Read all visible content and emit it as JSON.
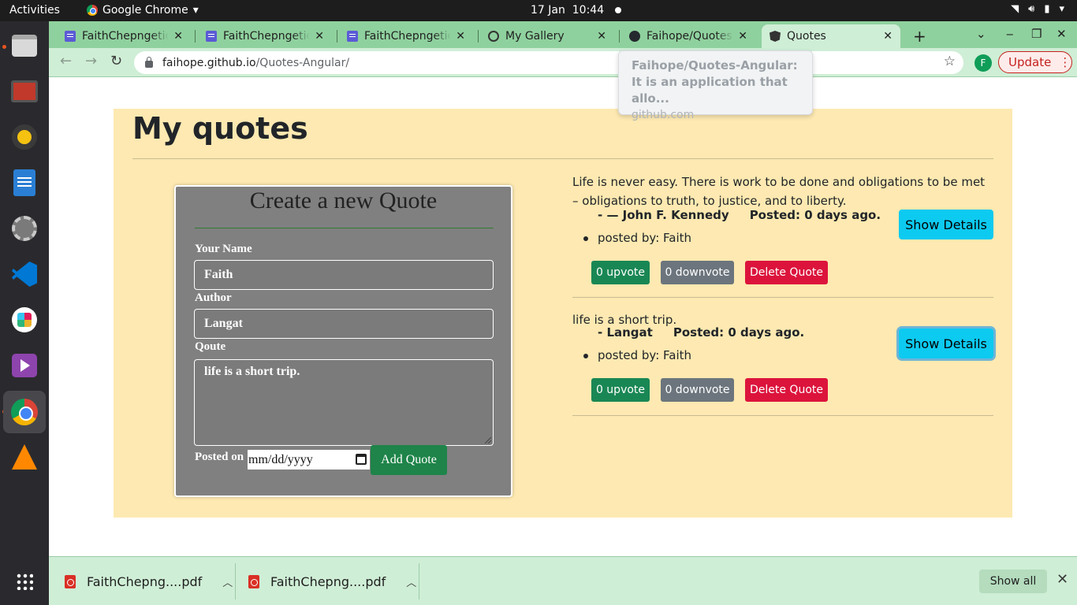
{
  "system_bar": {
    "activities": "Activities",
    "app_name": "Google Chrome",
    "date": "17 Jan",
    "time": "10:44"
  },
  "dock": {
    "items": [
      "files",
      "screen-recorder",
      "rhythmbox",
      "libreoffice-writer",
      "settings",
      "vscode",
      "slack",
      "video-player",
      "google-chrome",
      "vlc",
      "show-applications"
    ]
  },
  "browser": {
    "tabs": [
      {
        "title": "FaithChepngetich",
        "icon": "docs-icon"
      },
      {
        "title": "FaithChepngetich",
        "icon": "docs-icon"
      },
      {
        "title": "FaithChepngetich",
        "icon": "docs-icon"
      },
      {
        "title": "My Gallery",
        "icon": "globe-icon"
      },
      {
        "title": "Faihope/Quotes-Angular",
        "icon": "github-icon"
      },
      {
        "title": "Quotes",
        "icon": "angular-icon",
        "active": true
      }
    ],
    "url_host": "faihope.github.io",
    "url_path": "/Quotes-Angular/",
    "profile_initial": "F",
    "update_label": "Update",
    "tooltip": {
      "title": "Faihope/Quotes-Angular: It is an application that allo...",
      "host": "github.com"
    },
    "accent": "#8fd19e"
  },
  "page": {
    "title": "My quotes",
    "form": {
      "heading": "Create a new Quote",
      "name_label": "Your Name",
      "name_value": "Faith",
      "author_label": "Author",
      "author_value": "Langat",
      "quote_label": "Qoute",
      "quote_value": "life is a short trip.",
      "posted_label": "Posted on",
      "date_placeholder": "mm/dd/yyyy",
      "submit_label": "Add Quote"
    },
    "quotes": [
      {
        "text": "Life is never easy. There is work to be done and obligations to be met – obligations to truth, to justice, and to liberty.",
        "author": "- — John F. Kennedy",
        "posted": "Posted: 0 days ago.",
        "posted_by": "posted by: Faith",
        "upvote": "0 upvote",
        "downvote": "0 downvote",
        "delete": "Delete Quote",
        "details": "Show Details"
      },
      {
        "text": "life is a short trip.",
        "author": "- Langat",
        "posted": "Posted: 0 days ago.",
        "posted_by": "posted by: Faith",
        "upvote": "0 upvote",
        "downvote": "0 downvote",
        "delete": "Delete Quote",
        "details": "Show Details"
      }
    ],
    "colors": {
      "container_bg": "#fde9b1",
      "form_bg": "#808080",
      "upvote": "#198754",
      "downvote": "#6c757d",
      "delete": "#dc143c",
      "details": "#0dcaf0"
    }
  },
  "downloads": {
    "items": [
      {
        "name": "FaithChepng....pdf"
      },
      {
        "name": "FaithChepng....pdf"
      }
    ],
    "show_all": "Show all"
  }
}
